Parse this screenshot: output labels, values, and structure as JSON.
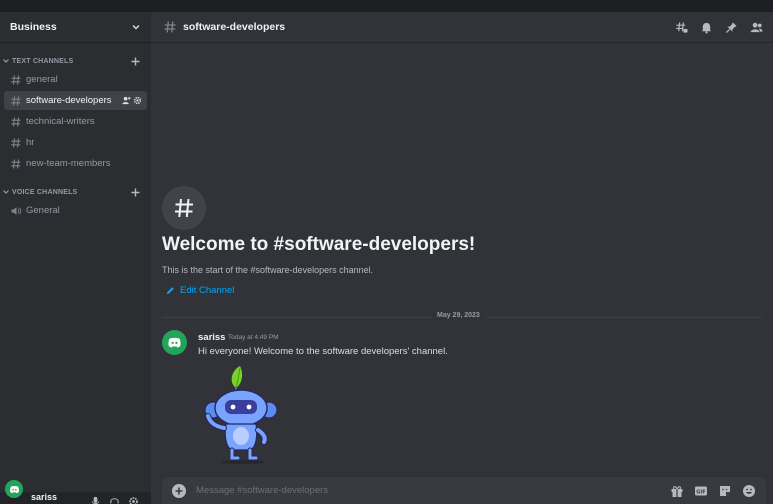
{
  "server": {
    "name": "Business"
  },
  "text_category": {
    "label": "TEXT CHANNELS"
  },
  "text_channels": [
    {
      "name": "general"
    },
    {
      "name": "software-developers"
    },
    {
      "name": "technical-writers"
    },
    {
      "name": "hr"
    },
    {
      "name": "new-team-members"
    }
  ],
  "voice_category": {
    "label": "VOICE CHANNELS"
  },
  "voice_channels": [
    {
      "name": "General"
    }
  ],
  "user": {
    "name": "sariss"
  },
  "topbar": {
    "channel_name": "software-developers"
  },
  "welcome": {
    "title": "Welcome to #software-developers!",
    "subtitle": "This is the start of the #software-developers channel.",
    "edit_label": "Edit Channel"
  },
  "date_divider": {
    "label": "May 29, 2023"
  },
  "message": {
    "author": "sariss",
    "time": "Today at 4:49 PM",
    "text": "Hi everyone! Welcome to the software developers' channel."
  },
  "composer": {
    "placeholder": "Message #software-developers"
  },
  "colors": {
    "accent": "#00a8fc",
    "avatar": "#23a559",
    "sidebar": "#2b2d31",
    "main": "#313338"
  },
  "icons": [
    "hashtag-icon",
    "bell-icon",
    "pin-icon",
    "members-icon",
    "gift-icon",
    "gif-icon",
    "sticker-icon",
    "emoji-icon",
    "mic-icon",
    "headphones-icon",
    "settings-icon"
  ]
}
